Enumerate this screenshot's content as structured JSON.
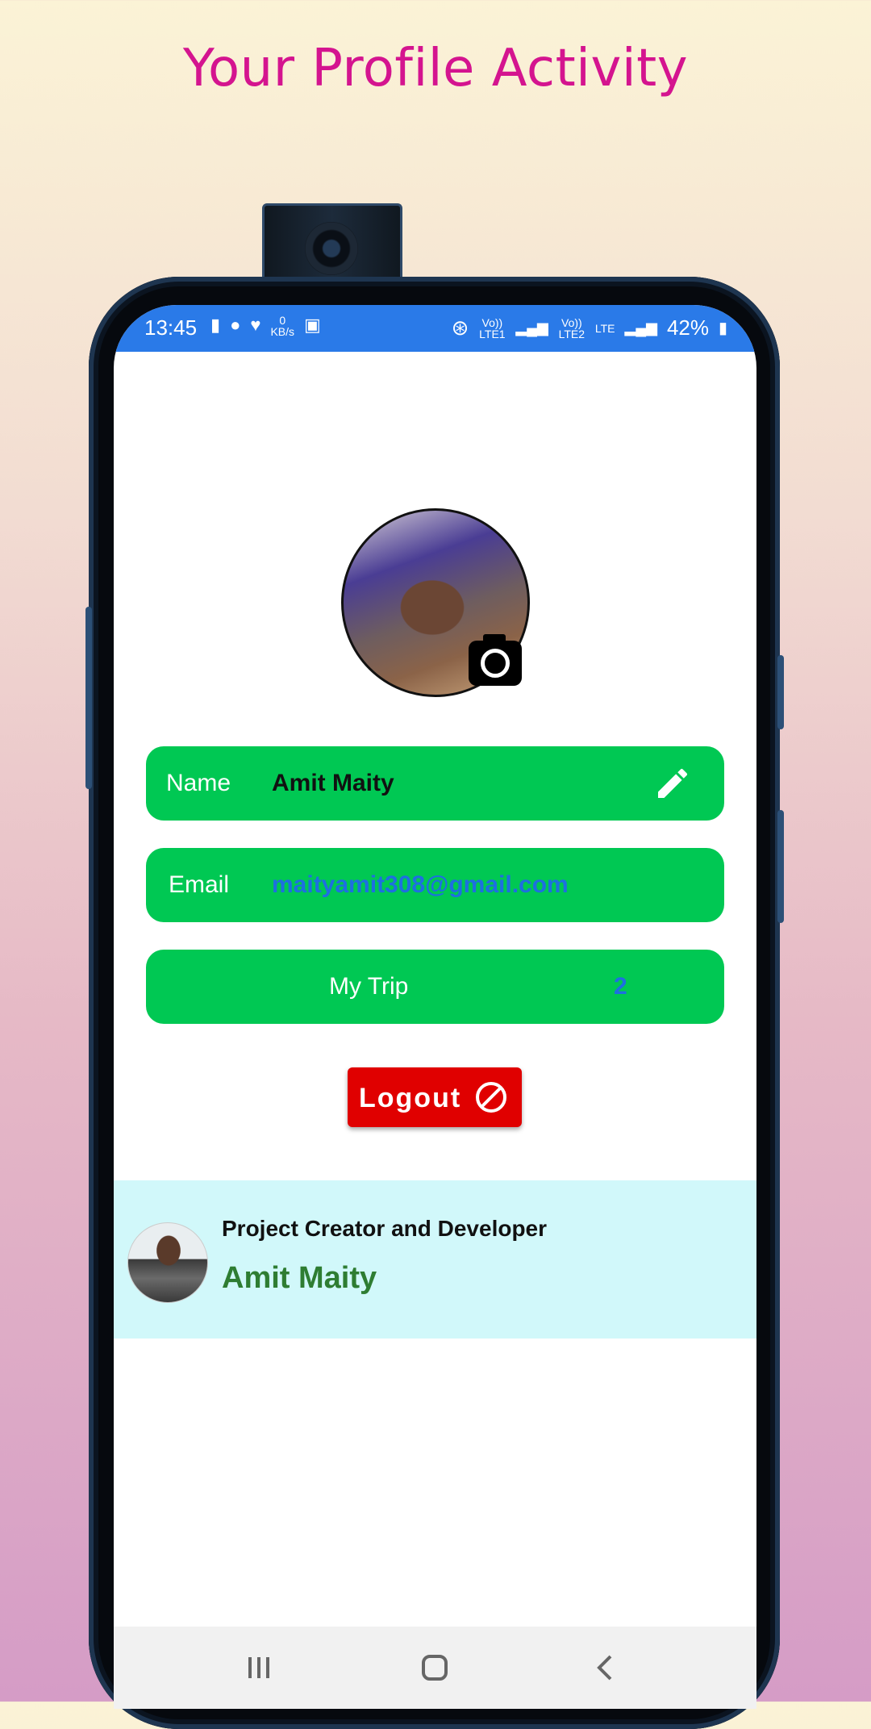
{
  "headline": "Your Profile Activity",
  "status_bar": {
    "time": "13:45",
    "net_speed_value": "0",
    "net_speed_unit": "KB/s",
    "volte1": "Vo)) LTE1",
    "volte2": "Vo)) LTE2",
    "lte": "LTE",
    "battery": "42%"
  },
  "profile": {
    "name_label": "Name",
    "name_value": "Amit Maity",
    "email_label": "Email",
    "email_value": "maityamit308@gmail.com",
    "trip_label": "My Trip",
    "trip_count": "2"
  },
  "logout_label": "Logout",
  "credit": {
    "title": "Project Creator and Developer",
    "name": "Amit Maity"
  },
  "colors": {
    "status_bar": "#2a7ae8",
    "field_green": "#00c853",
    "logout_red": "#e00000",
    "headline_pink": "#d4148f",
    "credit_bg": "#d1f8fa",
    "credit_name": "#2e7d32",
    "email_blue": "#1e6fe0"
  }
}
